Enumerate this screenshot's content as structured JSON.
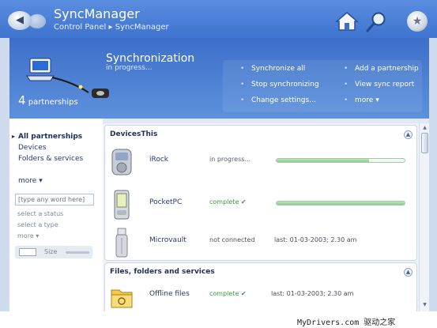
{
  "window": {
    "title": "SyncManager",
    "breadcrumb": [
      "Control Panel",
      "SyncManager"
    ],
    "breadcrumb_sep": "▸"
  },
  "icons": {
    "back": "back-arrow-icon",
    "forward": "forward-arrow-icon",
    "home": "home-icon",
    "search": "search-icon",
    "favorites": "star-icon"
  },
  "header": {
    "partner_count": "4",
    "partner_label": "partnerships",
    "title": "Synchronization",
    "status": "in progress...",
    "actions": [
      {
        "label": "Synchronize all"
      },
      {
        "label": "Stop synchronizing"
      },
      {
        "label": "Change settings..."
      },
      {
        "label": "Add a partnership"
      },
      {
        "label": "View sync report"
      },
      {
        "label": "more",
        "caret": "▾"
      }
    ]
  },
  "sidebar": {
    "links": [
      {
        "label": "All partnerships",
        "active": true
      },
      {
        "label": "Devices",
        "active": false
      },
      {
        "label": "Folders & services",
        "active": false
      }
    ],
    "more": "more",
    "caret": "▾",
    "search_placeholder": "[type any word here]",
    "filters": [
      "select a status",
      "select a type",
      "more"
    ],
    "size_label": "Size"
  },
  "groups": [
    {
      "title": "DevicesThis",
      "collapse": "▲",
      "rows": [
        {
          "name": "iRock",
          "icon": "mp3-player-icon",
          "status": "in progress...",
          "progress": 0.72
        },
        {
          "name": "PocketPC",
          "icon": "pda-icon",
          "status": "complete",
          "status_mark": "✔",
          "progress": 1.0
        },
        {
          "name": "Microvault",
          "icon": "usb-drive-icon",
          "status": "not connected",
          "last_sync": "last: 01-03-2003; 2.30 am"
        }
      ]
    },
    {
      "title": "Files, folders and services",
      "collapse": "▲",
      "rows": [
        {
          "name": "Offline files",
          "icon": "folder-icon",
          "status": "complete",
          "status_mark": "✔",
          "last_sync": "last: 01-03-2003; 2.30 am"
        }
      ]
    }
  ],
  "scrollbar": {
    "up": "▲",
    "down": "▼"
  },
  "watermark": "MyDrivers.com 驱动之家",
  "colors": {
    "titlebar": "#4a7fd7",
    "header": "#4c80d2",
    "progress": "#8ccf8c",
    "link": "#24387a"
  }
}
